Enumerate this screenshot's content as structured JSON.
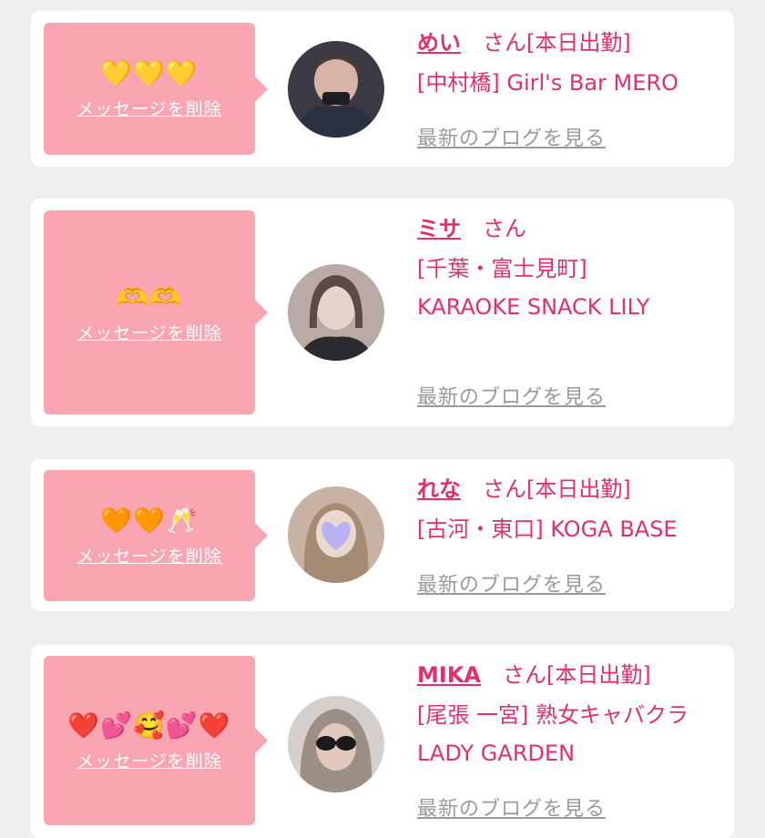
{
  "colors": {
    "background": "#efefef",
    "card": "#ffffff",
    "bubble": "#f9a6b2",
    "accent": "#e0306e",
    "muted": "#9a9a9a"
  },
  "cards": [
    {
      "message": "💛💛💛",
      "delete_label": "メッセージを削除",
      "avatar_icon": "avatar-photo",
      "name": "めい",
      "suffix": "さん[本日出勤]",
      "shop": "[中村橋] Girl's Bar MERO",
      "blog_label": "最新のブログを見る"
    },
    {
      "message": "🫶🫶",
      "delete_label": "メッセージを削除",
      "avatar_icon": "avatar-photo",
      "name": "ミサ",
      "suffix": "さん",
      "shop": "[千葉・富士見町] KARAOKE SNACK LILY",
      "blog_label": "最新のブログを見る"
    },
    {
      "message": "🧡🧡🥂",
      "delete_label": "メッセージを削除",
      "avatar_icon": "avatar-photo",
      "name": "れな",
      "suffix": "さん[本日出勤]",
      "shop": "[古河・東口] KOGA BASE",
      "blog_label": "最新のブログを見る"
    },
    {
      "message": "❤️💕🥰💕❤️",
      "delete_label": "メッセージを削除",
      "avatar_icon": "avatar-photo",
      "name": "MIKA",
      "suffix": "さん[本日出勤]",
      "shop": "[尾張 一宮] 熟女キャバクラ LADY GARDEN",
      "blog_label": "最新のブログを見る"
    }
  ]
}
